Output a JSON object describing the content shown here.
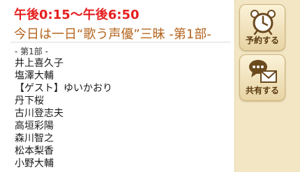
{
  "program": {
    "time": "午後0:15～午後6:50",
    "title": "今日は一日“歌う声優”三昧 -第1部-"
  },
  "details": {
    "section": "- 第1部 -",
    "lines": [
      "井上喜久子",
      "塩澤大輔",
      "【ゲスト】ゆいかおり",
      "丹下桜",
      "古川登志夫",
      "高垣彩陽",
      "森川智之",
      "松本梨香",
      "小野大輔"
    ]
  },
  "sidebar": {
    "reserve_label": "予約する",
    "share_label": "共有する"
  },
  "colors": {
    "time": "#e61e1e",
    "title": "#b4641e",
    "sidebar_bg": "#f3e6c4",
    "button_text": "#5a3a10"
  },
  "icons": {
    "reserve": "alarm-clock-icon",
    "share": "speech-bubble-envelope-icon"
  }
}
